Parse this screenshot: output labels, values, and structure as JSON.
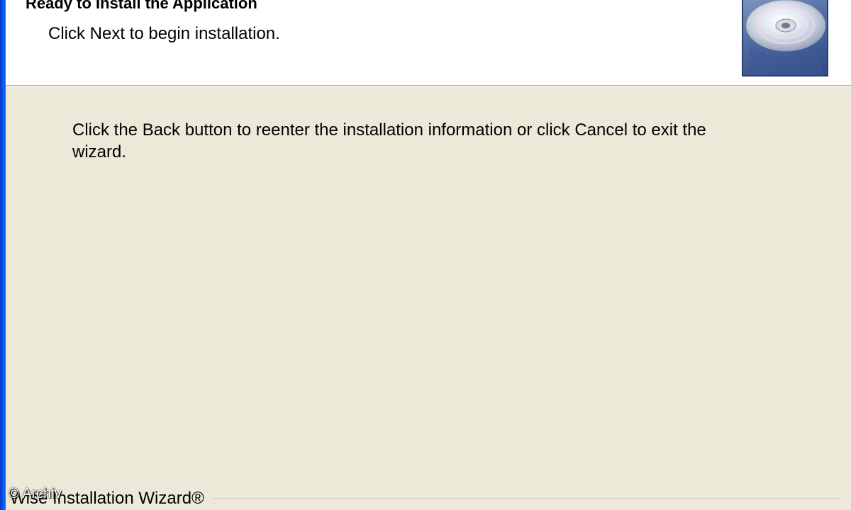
{
  "header": {
    "title": "Ready to Install the Application",
    "subtitle": "Click Next to begin installation.",
    "graphic_icon": "cd-disc-icon"
  },
  "main": {
    "instruction": "Click the Back button to reenter the installation information or click Cancel to exit the wizard."
  },
  "footer": {
    "brand": "Wise Installation Wizard®"
  },
  "watermark": "© Archiv",
  "colors": {
    "window_background": "#ece9d8",
    "header_background": "#ffffff",
    "frame_blue": "#0a5ae0"
  }
}
